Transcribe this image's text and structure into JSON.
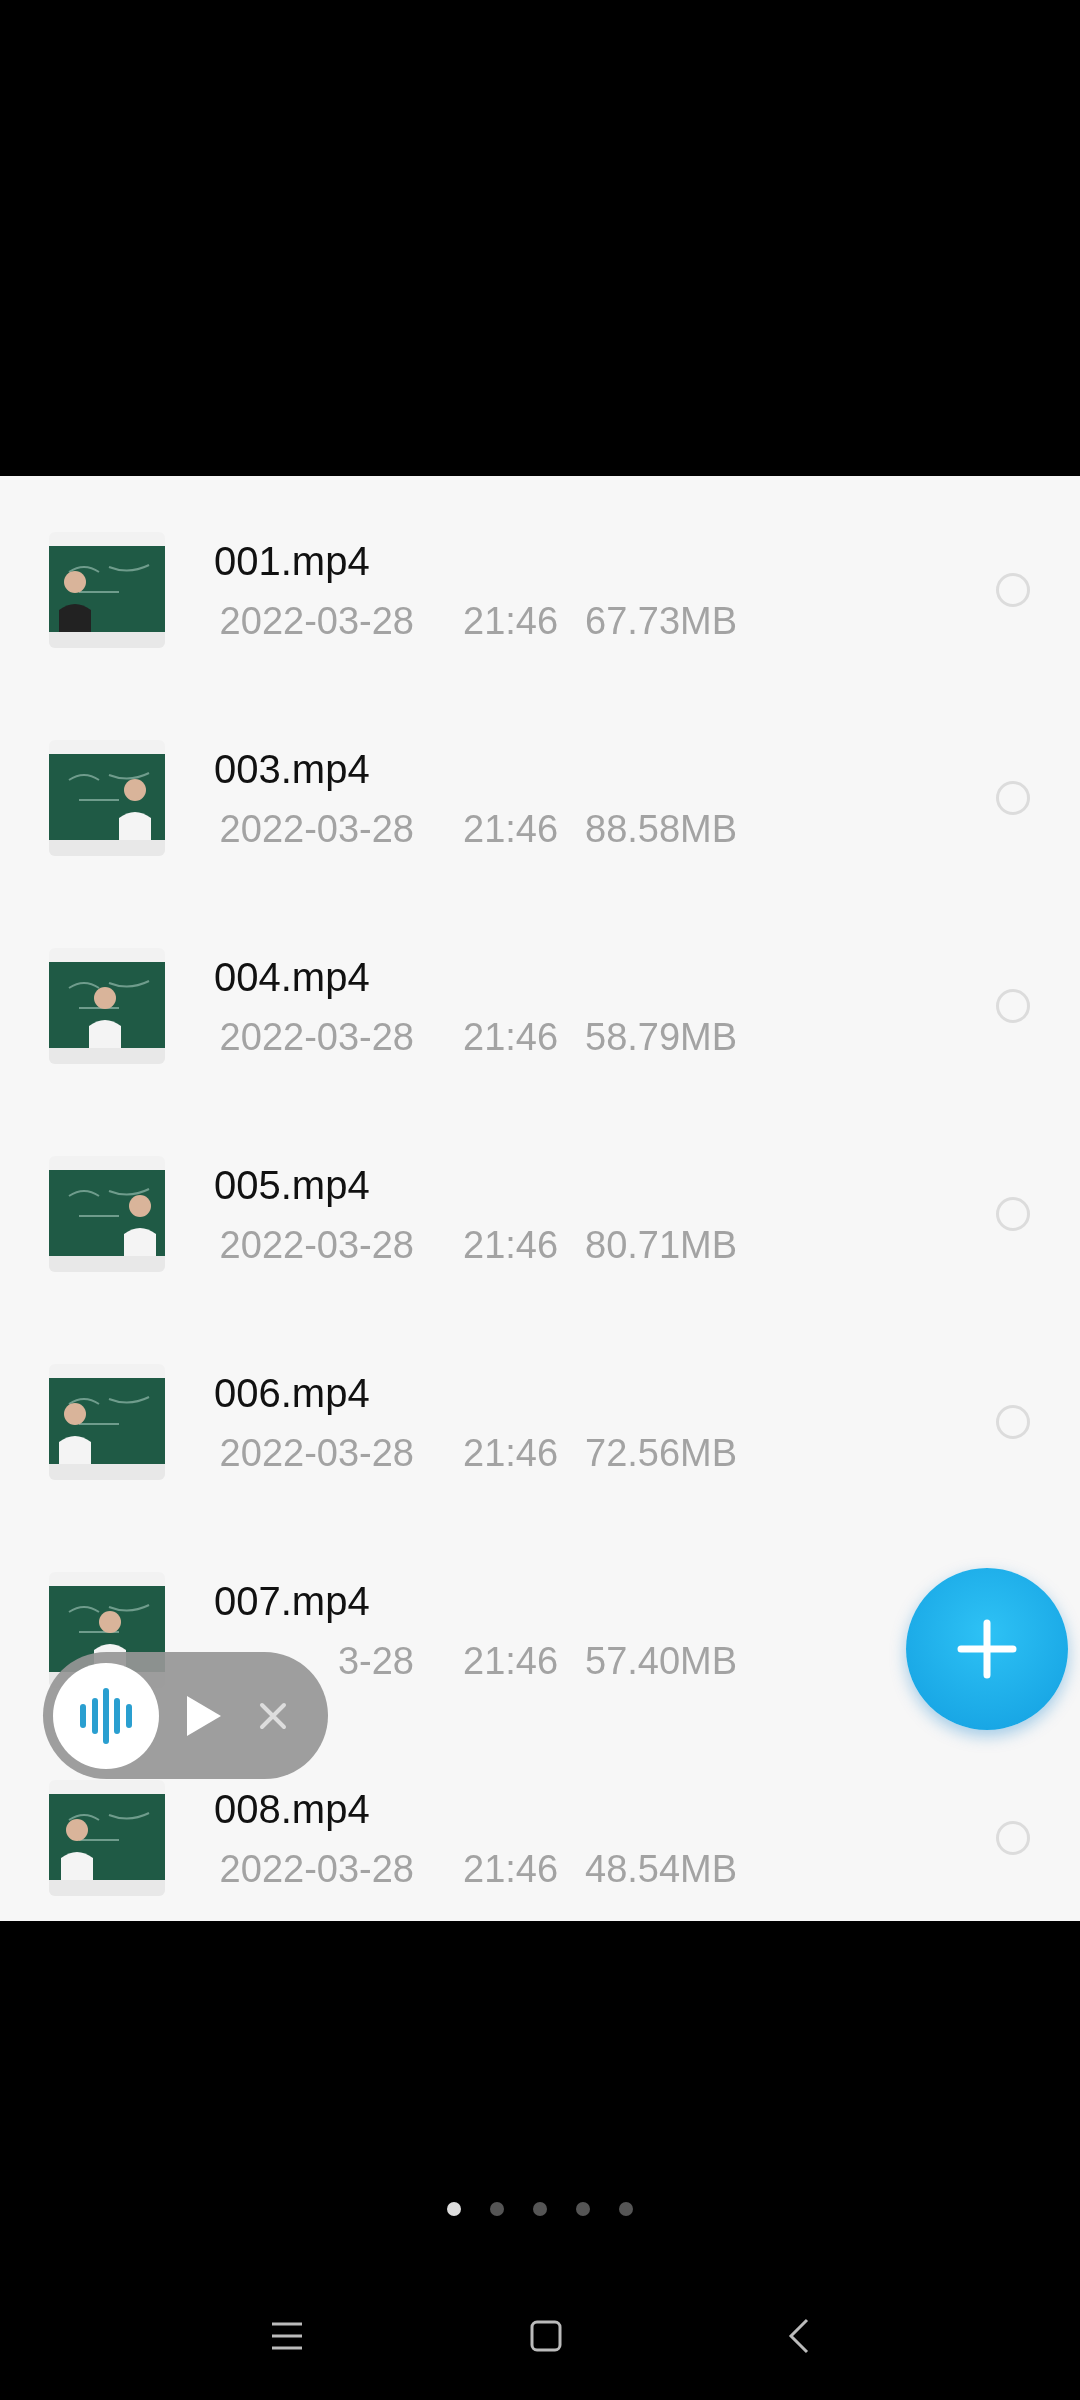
{
  "files": [
    {
      "kind": "picture",
      "title": "001.mp4",
      "date": "2022-03-28",
      "time": "21:46",
      "size": "67.73MB",
      "selected": false
    },
    {
      "kind": "picture",
      "title": "003.mp4",
      "date": "2022-03-28",
      "time": "21:46",
      "size": "88.58MB",
      "selected": false
    },
    {
      "kind": "picture",
      "title": "004.mp4",
      "date": "2022-03-28",
      "time": "21:46",
      "size": "58.79MB",
      "selected": false
    },
    {
      "kind": "picture",
      "title": "005.mp4",
      "date": "2022-03-28",
      "time": "21:46",
      "size": "80.71MB",
      "selected": false
    },
    {
      "kind": "picture",
      "title": "006.mp4",
      "date": "2022-03-28",
      "time": "21:46",
      "size": "72.56MB",
      "selected": false
    },
    {
      "kind": "picture",
      "title": "007.mp4",
      "date": "3-28",
      "time": "21:46",
      "size": "57.40MB"
    },
    {
      "kind": "picture",
      "title": "008.mp4",
      "date": "2022-03-28",
      "time": "21:46",
      "size": "48.54MB",
      "selected": false
    }
  ],
  "pager": [
    {
      "selected": true
    },
    {
      "selected": false
    },
    {
      "selected": false
    },
    {
      "selected": false
    },
    {
      "selected": false
    }
  ]
}
